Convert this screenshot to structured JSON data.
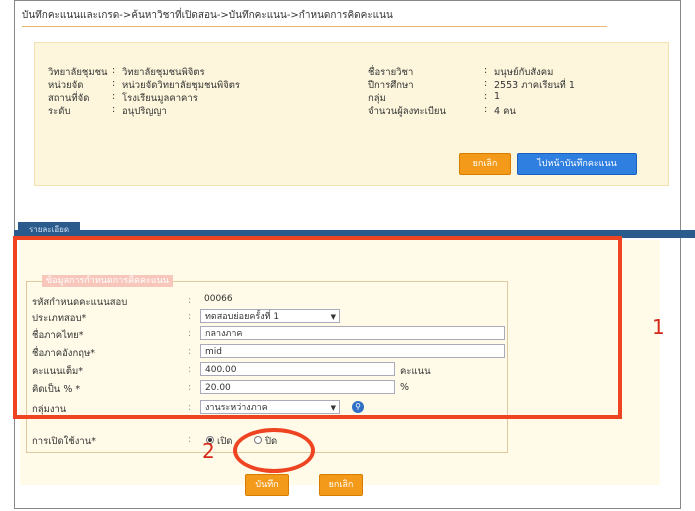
{
  "breadcrumb": "บันทึกคะแนนและเกรด->ค้นหาวิชาที่เปิดสอน->บันทึกคะแนน->กำหนดการคิดคะแนน",
  "info": {
    "college_label": "วิทยาลัยชุมชน",
    "college_value": "วิทยาลัยชุมชนพิจิตร",
    "unit_label": "หน่วยจัด",
    "unit_value": "หน่วยจัดวิทยาลัยชุมชนพิจิตร",
    "place_label": "สถานที่จัด",
    "place_value": "โรงเรียนมูลคาคาร",
    "level_label": "ระดับ",
    "level_value": "อนุปริญญา",
    "subject_label": "ชื่อรายวิชา",
    "subject_value": "มนุษย์กับสังคม",
    "year_label": "ปีการศึกษา",
    "year_value": "2553 ภาคเรียนที่ 1",
    "group_label": "กลุ่ม",
    "group_value": "1",
    "students_label": "จำนวนผู้ลงทะเบียน",
    "students_value": "4 คน",
    "sep": ":"
  },
  "buttons": {
    "cancel_top": "ยกเลิก",
    "save_score": "ไปหน้าบันทึกคะแนน",
    "save": "บันทึก",
    "cancel": "ยกเลิก"
  },
  "tab_label": "รายละเอียด",
  "form": {
    "legend": "ข้อมูลการกำหนดการคิดคะแนน",
    "sep": ":",
    "code_label": "รหัสกำหนดคะแนนสอบ",
    "code_value": "00066",
    "type_label": "ประเภทสอบ*",
    "type_value": "ทดสอบย่อยครั้งที่ 1",
    "name_th_label": "ชื่อภาคไทย*",
    "name_th_value": "กลางภาค",
    "name_en_label": "ชื่อภาคอังกฤษ*",
    "name_en_value": "mid",
    "full_score_label": "คะแนนเต็ม*",
    "full_score_value": "400.00",
    "full_score_unit": "คะแนน",
    "percent_label": "คิดเป็น % *",
    "percent_value": "20.00",
    "percent_unit": "%",
    "group_label": "กลุ่มงาน",
    "group_value": "งานระหว่างภาค",
    "status_label": "การเปิดใช้งาน*",
    "status_on": "เปิด",
    "status_off": "ปิด"
  },
  "annotations": {
    "one": "1",
    "two": "2"
  },
  "colors": {
    "accent_orange": "#f39a1a",
    "accent_blue": "#2f7fe0",
    "annotation_red": "#ee4422"
  }
}
